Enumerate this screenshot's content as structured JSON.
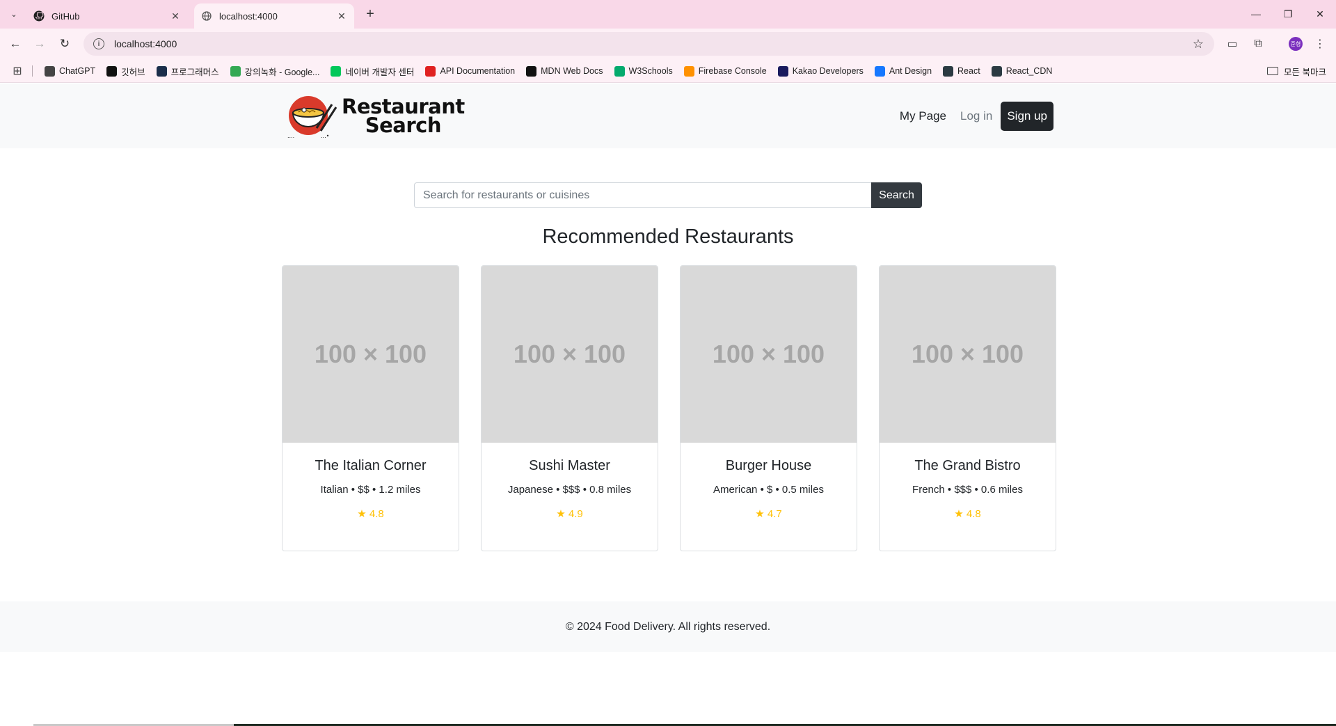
{
  "browser": {
    "tabs": [
      {
        "title": "GitHub",
        "active": false,
        "icon": "github-icon"
      },
      {
        "title": "localhost:4000",
        "active": true,
        "icon": "globe-icon"
      }
    ],
    "address": "localhost:4000",
    "bookmarks": [
      {
        "label": "ChatGPT",
        "icon": "chatgpt-icon",
        "color": "#444444"
      },
      {
        "label": "깃허브",
        "icon": "github-icon",
        "color": "#111111"
      },
      {
        "label": "프로그래머스",
        "icon": "programmers-icon",
        "color": "#1b2e4b"
      },
      {
        "label": "강의녹화 - Google...",
        "icon": "google-drive-icon",
        "color": "#34a853"
      },
      {
        "label": "네이버 개발자 센터",
        "icon": "naver-icon",
        "color": "#03c75a"
      },
      {
        "label": "API Documentation",
        "icon": "api-icon",
        "color": "#e02020"
      },
      {
        "label": "MDN Web Docs",
        "icon": "mdn-icon",
        "color": "#111111"
      },
      {
        "label": "W3Schools",
        "icon": "w3schools-icon",
        "color": "#04aa6d"
      },
      {
        "label": "Firebase Console",
        "icon": "firebase-icon",
        "color": "#ff9100"
      },
      {
        "label": "Kakao Developers",
        "icon": "kakao-icon",
        "color": "#1a1a5e"
      },
      {
        "label": "Ant Design",
        "icon": "ant-design-icon",
        "color": "#1677ff"
      },
      {
        "label": "React",
        "icon": "react-icon",
        "color": "#2b3a42"
      },
      {
        "label": "React_CDN",
        "icon": "react-icon",
        "color": "#2b3a42"
      }
    ],
    "all_bookmarks": "모든 북마크",
    "profile_initials": "준형"
  },
  "site": {
    "logo_line1": "Restaurant",
    "logo_line2": "Search",
    "nav": {
      "my_page": "My Page",
      "login": "Log in",
      "signup": "Sign up"
    },
    "search": {
      "placeholder": "Search for restaurants or cuisines",
      "button": "Search"
    },
    "section_title": "Recommended Restaurants",
    "restaurants": [
      {
        "image_text": "100 × 100",
        "name": "The Italian Corner",
        "meta": "Italian • $$ • 1.2 miles",
        "rating": "★ 4.8"
      },
      {
        "image_text": "100 × 100",
        "name": "Sushi Master",
        "meta": "Japanese • $$$ • 0.8 miles",
        "rating": "★ 4.9"
      },
      {
        "image_text": "100 × 100",
        "name": "Burger House",
        "meta": "American • $ • 0.5 miles",
        "rating": "★ 4.7"
      },
      {
        "image_text": "100 × 100",
        "name": "The Grand Bistro",
        "meta": "French • $$$ • 0.6 miles",
        "rating": "★ 4.8"
      }
    ],
    "footer": "© 2024 Food Delivery. All rights reserved."
  },
  "colors": {
    "tabbar": "#f9d8e8",
    "toolbar": "#fdf0f6",
    "header_bg": "#f8f9fa",
    "dark_button": "#212529",
    "rating": "#ffc107",
    "placeholder_bg": "#d9d9d9"
  }
}
